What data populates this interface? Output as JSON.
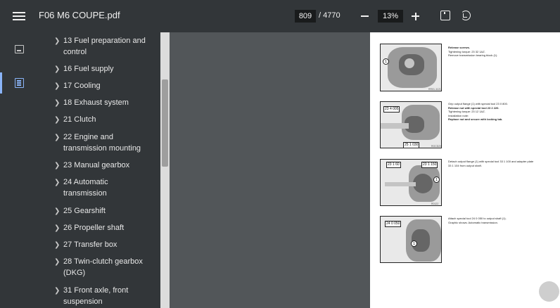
{
  "toolbar": {
    "title": "F06 M6 COUPE.pdf",
    "current_page": "809",
    "page_total": "/ 4770",
    "zoom": "13%",
    "icons": [
      "menu-icon",
      "zoom-out-icon",
      "zoom-in-icon",
      "fit-to-page-icon",
      "rotate-icon"
    ]
  },
  "rail": {
    "items": [
      {
        "name": "thumbnails",
        "icon": "thumbnail-icon"
      },
      {
        "name": "outline",
        "icon": "outline-icon",
        "active": true
      }
    ]
  },
  "outline": {
    "items": [
      {
        "label": "13 Fuel preparation and control"
      },
      {
        "label": "16 Fuel supply"
      },
      {
        "label": "17 Cooling"
      },
      {
        "label": "18 Exhaust system"
      },
      {
        "label": "21 Clutch"
      },
      {
        "label": "22 Engine and transmission mounting"
      },
      {
        "label": "23 Manual gearbox"
      },
      {
        "label": "24 Automatic transmission"
      },
      {
        "label": "25 Gearshift"
      },
      {
        "label": "26 Propeller shaft"
      },
      {
        "label": "27 Transfer box"
      },
      {
        "label": "28 Twin-clutch gearbox (DKG)"
      },
      {
        "label": "31 Front axle, front suspension"
      }
    ]
  },
  "document": {
    "figures": [
      {
        "callouts": [
          "1"
        ],
        "code": "RR01-1121",
        "text": [
          "Release screws.",
          "Tightening torque: 23 32 1AZ.",
          "Remove transmission bearing block (1)."
        ]
      },
      {
        "tags": [
          "23 4 005",
          "25 1 030"
        ],
        "code": "ROCD2X",
        "text": [
          "Grip output flange (1) with special tool 23 0 800.",
          "Release nut with special tool 23 2 220.",
          "Tightening torque: 23 12 1AZ.",
          "Installation note:",
          "Replace nut and secure with locking tab."
        ]
      },
      {
        "tags": [
          "23 1 150"
        ],
        "callouts": [
          "1"
        ],
        "code": "R0122",
        "text": [
          "Detach output flange (1) with special tool 33 1 100 and adapter plate",
          "33 1 104 from output shaft."
        ]
      },
      {
        "tags": [
          "24 0 050"
        ],
        "callouts": [
          "1"
        ],
        "code": "",
        "text": [
          "Attach special tool 24 0 050 to output shaft (1).",
          "Graphic shows: Automatic transmission."
        ]
      }
    ]
  }
}
